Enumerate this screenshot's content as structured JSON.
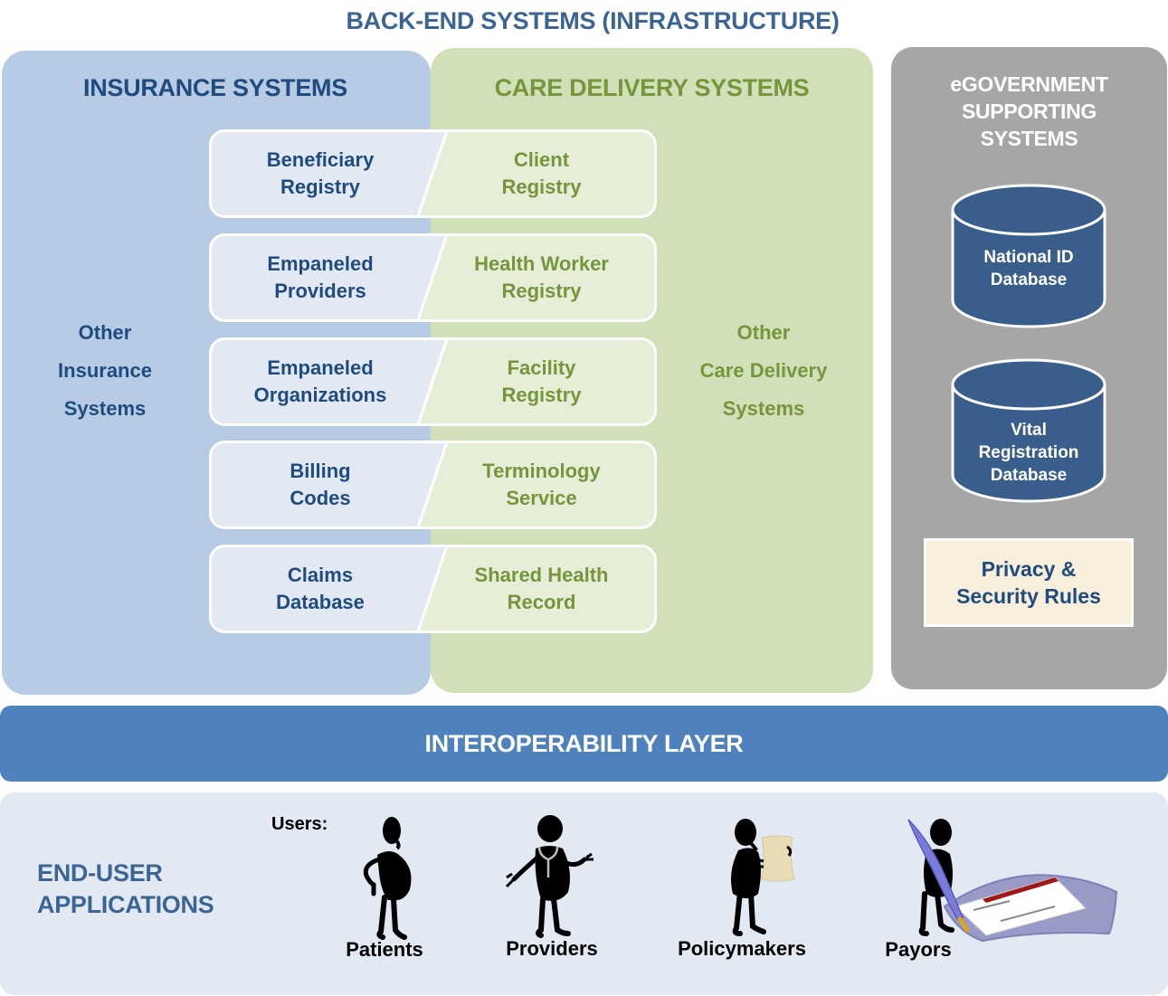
{
  "title": "BACK-END SYSTEMS (INFRASTRUCTURE)",
  "colors": {
    "insurance_panel": "#b7cce4",
    "care_panel": "#d2e0b9",
    "egov_panel": "#a6a6a6",
    "insurance_text": "#1f4b7e",
    "care_text": "#76963c",
    "database": "#3a5e8c",
    "interop_bar": "#4f81bd",
    "enduser_panel": "#e3e9f3",
    "privacy_box": "#f7eedb"
  },
  "insurance": {
    "header": "INSURANCE SYSTEMS",
    "other": [
      "Other",
      "Insurance",
      "Systems"
    ]
  },
  "care": {
    "header": "CARE DELIVERY SYSTEMS",
    "other": [
      "Other",
      "Care Delivery",
      "Systems"
    ]
  },
  "pairs": [
    {
      "insurance": [
        "Beneficiary",
        "Registry"
      ],
      "care": [
        "Client",
        "Registry"
      ]
    },
    {
      "insurance": [
        "Empaneled",
        "Providers"
      ],
      "care": [
        "Health Worker",
        "Registry"
      ]
    },
    {
      "insurance": [
        "Empaneled",
        "Organizations"
      ],
      "care": [
        "Facility",
        "Registry"
      ]
    },
    {
      "insurance": [
        "Billing",
        "Codes"
      ],
      "care": [
        "Terminology",
        "Service"
      ]
    },
    {
      "insurance": [
        "Claims",
        "Database"
      ],
      "care": [
        "Shared Health",
        "Record"
      ]
    }
  ],
  "egov": {
    "header": [
      "eGOVERNMENT",
      "SUPPORTING",
      "SYSTEMS"
    ],
    "databases": [
      {
        "icon": "database-icon",
        "lines": [
          "National ID",
          "Database"
        ]
      },
      {
        "icon": "database-icon",
        "lines": [
          "Vital",
          "Registration",
          "Database"
        ]
      }
    ],
    "privacy": [
      "Privacy &",
      "Security Rules"
    ]
  },
  "interop": {
    "label": "INTEROPERABILITY LAYER"
  },
  "end_user": {
    "label": [
      "END-USER",
      "APPLICATIONS"
    ],
    "users_label": "Users:",
    "users": [
      {
        "name": "Patients",
        "icon": "patient-figure-icon"
      },
      {
        "name": "Providers",
        "icon": "provider-figure-icon"
      },
      {
        "name": "Policymakers",
        "icon": "policymaker-figure-icon"
      },
      {
        "name": "Payors",
        "icon": "payor-figure-icon"
      }
    ]
  }
}
